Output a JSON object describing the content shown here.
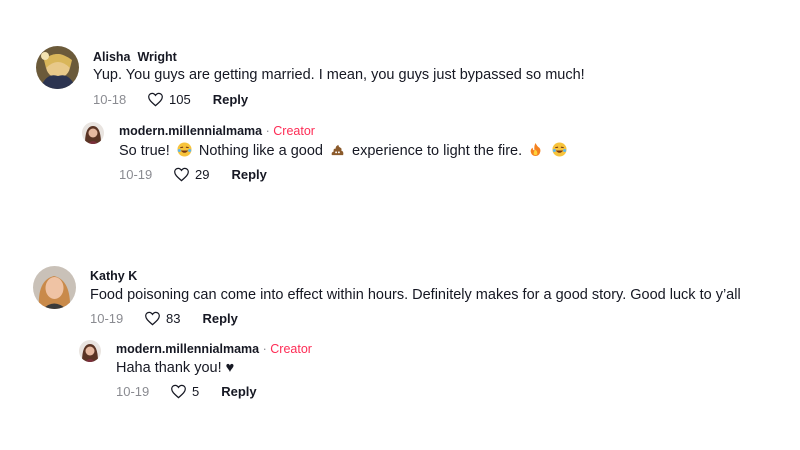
{
  "threads": [
    {
      "comment": {
        "username": "Alisha  Wright",
        "text": "Yup. You guys are getting married. I mean, you guys just bypassed so much!",
        "date": "10-18",
        "likes": "105",
        "reply_label": "Reply"
      },
      "reply": {
        "username": "modern.millennialmama",
        "separator": "·",
        "badge": "Creator",
        "text_parts": [
          "So true! ",
          " Nothing like a good ",
          " experience to light the fire. "
        ],
        "emojis": [
          "laughing-emoji",
          "poop-emoji",
          "fire-emoji",
          "laughing-emoji"
        ],
        "date": "10-19",
        "likes": "29",
        "reply_label": "Reply"
      }
    },
    {
      "comment": {
        "username": "Kathy K",
        "text": "Food poisoning can come into effect within hours. Definitely makes for a good story. Good luck to y’all",
        "date": "10-19",
        "likes": "83",
        "reply_label": "Reply"
      },
      "reply": {
        "username": "modern.millennialmama",
        "separator": "·",
        "badge": "Creator",
        "text": "Haha thank you! ♥",
        "date": "10-19",
        "likes": "5",
        "reply_label": "Reply"
      }
    }
  ],
  "colors": {
    "creator_badge": "#fe2c55",
    "meta_text": "#8a8b91",
    "primary_text": "#161823"
  },
  "icons": {
    "like": "heart-outline-icon"
  }
}
